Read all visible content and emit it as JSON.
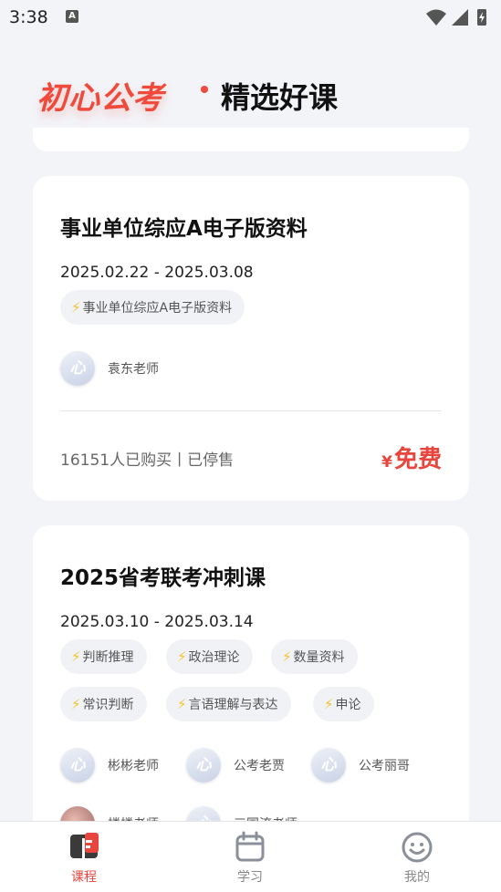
{
  "status": {
    "time": "3:38",
    "notif_icon": "A"
  },
  "header": {
    "brand": "初心公考",
    "title": "精选好课"
  },
  "courses": [
    {
      "title": "事业单位综应A电子版资料",
      "date": "2025.02.22 - 2025.03.08",
      "tags": [
        "事业单位综应A电子版资料"
      ],
      "teachers": [
        "袁东老师"
      ],
      "sales": "16151人已购买丨已停售",
      "price_symbol": "¥",
      "price": "免费"
    },
    {
      "title": "2025省考联考冲刺课",
      "date": "2025.03.10 - 2025.03.14",
      "tags": [
        "判断推理",
        "政治理论",
        "数量资料",
        "常识判断",
        "言语理解与表达",
        "申论"
      ],
      "teachers": [
        "彬彬老师",
        "公考老贾",
        "公考丽哥",
        "楼楼老师",
        "三国流老师"
      ]
    }
  ],
  "tabbar": {
    "courses": "课程",
    "study": "学习",
    "mine": "我的"
  },
  "colors": {
    "accent": "#e8453c",
    "bolt": "#f6c12b",
    "background": "#f3f4f8"
  }
}
